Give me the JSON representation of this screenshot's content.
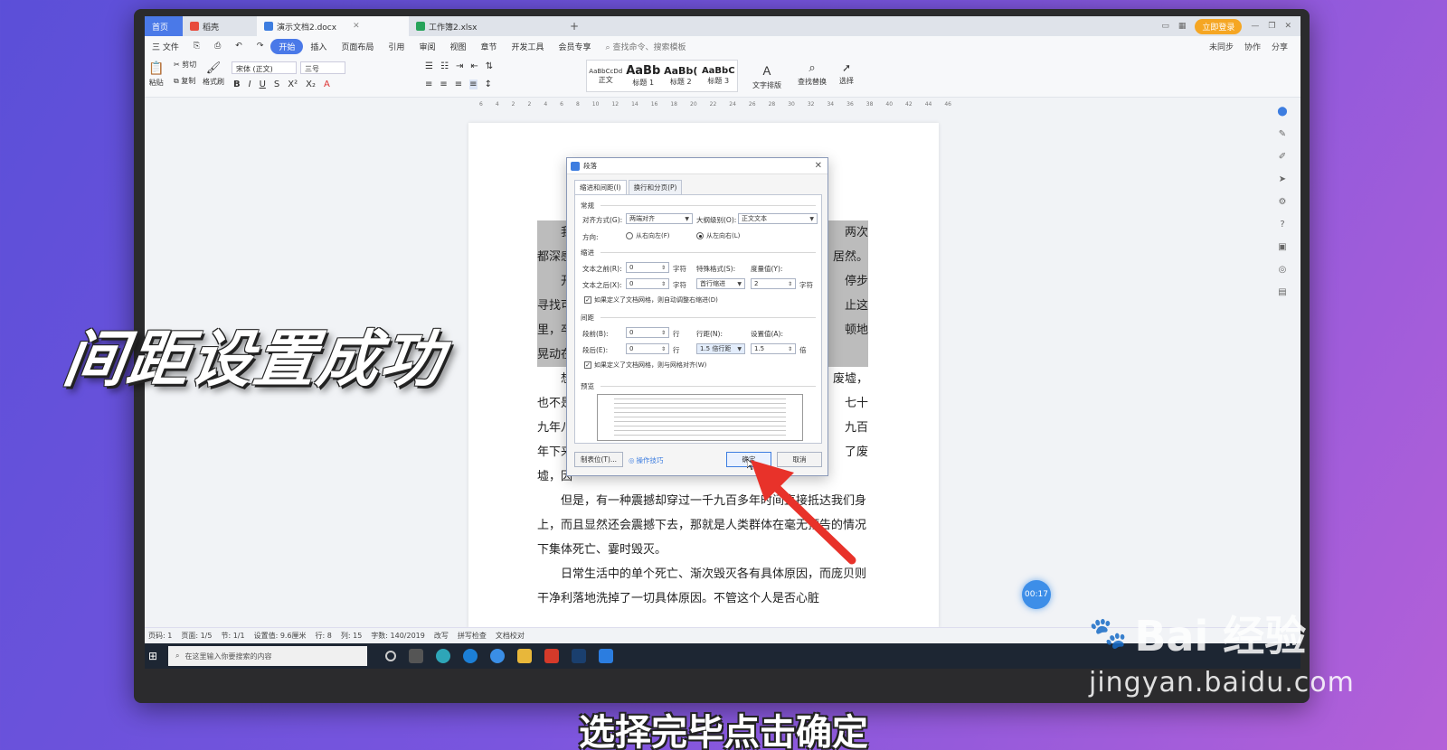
{
  "tabs": {
    "home": "首页",
    "shell": "稻壳",
    "doc": "演示文档2.docx",
    "sheet": "工作簿2.xlsx",
    "upgrade": "立即登录"
  },
  "menu": {
    "file": "三 文件",
    "items": [
      "开始",
      "插入",
      "页面布局",
      "引用",
      "审阅",
      "视图",
      "章节",
      "开发工具",
      "会员专享"
    ],
    "search": "查找命令、搜索模板",
    "right": [
      "未同步",
      "协作",
      "分享"
    ]
  },
  "ribbon": {
    "paste": "粘贴",
    "cut": "剪切",
    "copy": "复制",
    "format_painter": "格式刷",
    "font_name": "宋体 (正文)",
    "font_size": "三号",
    "styles": [
      {
        "preview": "AaBbCcDd",
        "name": "正文"
      },
      {
        "preview": "AaBb",
        "name": "标题 1"
      },
      {
        "preview": "AaBb(",
        "name": "标题 2"
      },
      {
        "preview": "AaBbC",
        "name": "标题 3"
      }
    ],
    "text_layout": "文字排版",
    "find_replace": "查找替换",
    "select": "选择"
  },
  "ruler": [
    "6",
    "4",
    "2",
    "2",
    "4",
    "6",
    "8",
    "10",
    "12",
    "14",
    "16",
    "18",
    "20",
    "22",
    "24",
    "26",
    "28",
    "30",
    "32",
    "34",
    "36",
    "38",
    "40",
    "42",
    "44",
    "46"
  ],
  "document": {
    "p1_a": "我",
    "p1_b": "两次",
    "p1_c": "都深感",
    "p1_d": "居然。",
    "p2_a": "开",
    "p2_b": "停步",
    "p2_c": "寻找可",
    "p2_d": "止这",
    "p2_e": "里，卒",
    "p2_f": "顿地",
    "p2_g": "晃动在",
    "p3_a": "想",
    "p3_b": "废墟，",
    "p3_c": "也不是",
    "p3_d": "七十",
    "p3_e": "九年八",
    "p3_f": "九百",
    "p3_g": "年下来",
    "p3_h": "了废",
    "p3_i": "墟，因",
    "p4": "但是，有一种震撼却穿过一千九百多年时间直接抵达我们身上，而且显然还会震撼下去，那就是人类群体在毫无预告的情况下集体死亡、霎时毁灭。",
    "p5": "日常生活中的单个死亡、渐次毁灭各有具体原因，而庞贝则干净利落地洗掉了一切具体原因。不管这个人是否心脏"
  },
  "dialog": {
    "title": "段落",
    "tab_indent": "缩进和间距(I)",
    "tab_break": "换行和分页(P)",
    "general": "常规",
    "align_label": "对齐方式(G):",
    "align_value": "两端对齐",
    "outline_label": "大纲级别(O):",
    "outline_value": "正文文本",
    "direction_label": "方向:",
    "rtl": "从右向左(F)",
    "ltr": "从左向右(L)",
    "indent": "缩进",
    "before_text_label": "文本之前(R):",
    "before_text_value": "0",
    "after_text_label": "文本之后(X):",
    "after_text_value": "0",
    "unit_char": "字符",
    "special_label": "特殊格式(S):",
    "special_value": "首行缩进",
    "measure_label": "度量值(Y):",
    "measure_value": "2",
    "grid_indent": "如果定义了文档网格，则自动调整右缩进(D)",
    "spacing": "间距",
    "before_label": "段前(B):",
    "before_value": "0",
    "after_label": "段后(E):",
    "after_value": "0",
    "unit_line": "行",
    "line_label": "行距(N):",
    "line_value": "1.5 倍行距",
    "set_label": "设置值(A):",
    "set_value": "1.5",
    "unit_times": "倍",
    "grid_align": "如果定义了文档网格，则与网格对齐(W)",
    "preview": "预览",
    "tabs_btn": "制表位(T)...",
    "tips": "操作技巧",
    "ok": "确定",
    "cancel": "取消"
  },
  "status": {
    "items": [
      "页码: 1",
      "页面: 1/5",
      "节: 1/1",
      "设置值: 9.6厘米",
      "行: 8",
      "列: 15",
      "字数: 140/2019",
      "改写",
      "拼写检查",
      "文档校对"
    ]
  },
  "taskbar": {
    "search": "在这里输入你要搜索的内容",
    "time": "00:17"
  },
  "overlay": {
    "caption": "间距设置成功",
    "subtitle": "选择完毕点击确定",
    "watermark_brand": "Bai 经验",
    "watermark_url": "jingyan.baidu.com"
  },
  "colors": {
    "accent": "#4a79e8",
    "arrow": "#e8322a",
    "timer": "#3d8ee8"
  }
}
